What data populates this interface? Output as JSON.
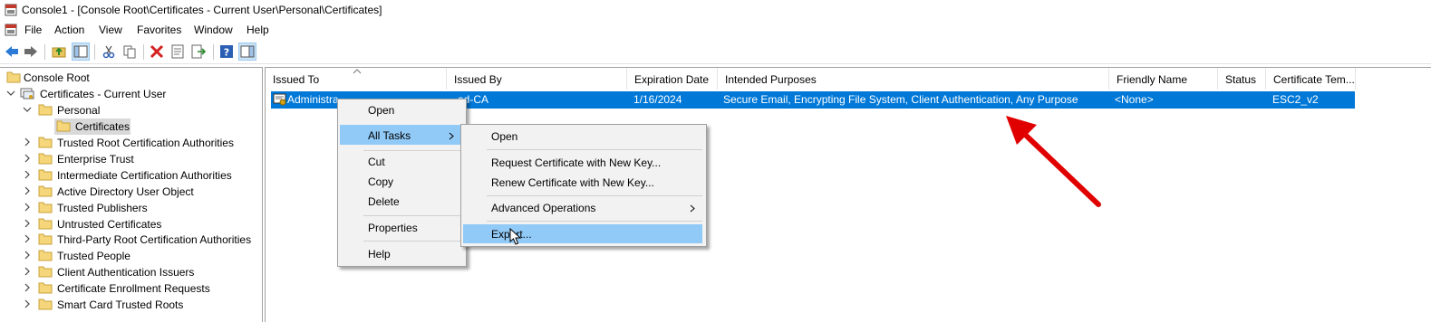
{
  "window": {
    "title": "Console1 - [Console Root\\Certificates - Current User\\Personal\\Certificates]"
  },
  "menubar": {
    "items": [
      "File",
      "Action",
      "View",
      "Favorites",
      "Window",
      "Help"
    ]
  },
  "toolbar": {
    "icons": [
      "back-arrow-icon",
      "forward-arrow-icon",
      "up-folder-icon",
      "show-hide-tree-icon",
      "cut-icon",
      "copy-icon",
      "delete-icon",
      "properties-icon",
      "export-list-icon",
      "help-icon",
      "action-pane-icon"
    ]
  },
  "tree": {
    "root": "Console Root",
    "store": "Certificates - Current User",
    "personal": "Personal",
    "certificates": "Certificates",
    "children": [
      "Trusted Root Certification Authorities",
      "Enterprise Trust",
      "Intermediate Certification Authorities",
      "Active Directory User Object",
      "Trusted Publishers",
      "Untrusted Certificates",
      "Third-Party Root Certification Authorities",
      "Trusted People",
      "Client Authentication Issuers",
      "Certificate Enrollment Requests",
      "Smart Card Trusted Roots"
    ]
  },
  "list": {
    "columns": [
      "Issued To",
      "Issued By",
      "Expiration Date",
      "Intended Purposes",
      "Friendly Name",
      "Status",
      "Certificate Tem..."
    ],
    "rows": [
      {
        "issued_to": "Administra",
        "issued_by": "ad-CA",
        "expiration": "1/16/2024",
        "purposes": "Secure Email, Encrypting File System, Client Authentication, Any Purpose",
        "friendly": "<None>",
        "status": "",
        "template": "ESC2_v2"
      }
    ]
  },
  "context_menu": {
    "items": [
      "Open",
      "All Tasks",
      "Cut",
      "Copy",
      "Delete",
      "Properties",
      "Help"
    ],
    "highlighted": "All Tasks"
  },
  "submenu": {
    "items": [
      "Open",
      "Request Certificate with New Key...",
      "Renew Certificate with New Key...",
      "Advanced Operations",
      "Export..."
    ],
    "highlighted": "Export..."
  },
  "colors": {
    "selection": "#0078d7",
    "menu_highlight": "#91c9f7",
    "arrow": "#e00000"
  }
}
